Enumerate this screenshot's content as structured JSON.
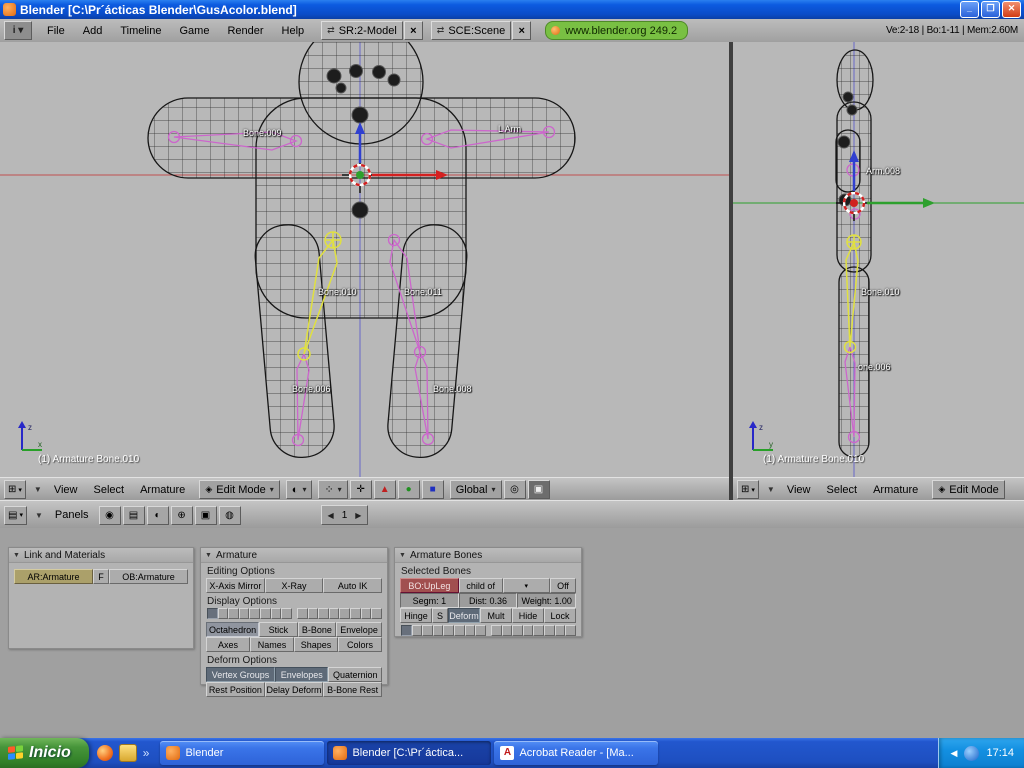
{
  "window": {
    "title": "Blender [C:\\Pr´ácticas Blender\\GusAcolor.blend]"
  },
  "menubar": {
    "menus": [
      "File",
      "Add",
      "Timeline",
      "Game",
      "Render",
      "Help"
    ],
    "screen": "SR:2-Model",
    "scene": "SCE:Scene",
    "web": "www.blender.org 249.2",
    "stats": "Ve:2-18 | Bo:1-11 | Mem:2.60M"
  },
  "viewport_front": {
    "labels": [
      "Bone.009",
      "L Arm",
      "Bone.010",
      "Bone.011",
      "Bone.006",
      "Bone.008"
    ],
    "status": "(1) Armature Bone.010",
    "axis_v": "z",
    "axis_h": "x"
  },
  "viewport_side": {
    "labels": [
      "Arm.008",
      "Bone.010",
      "one.006"
    ],
    "status": "(1) Armature Bone.010",
    "axis_v": "z",
    "axis_h": "y"
  },
  "header_front": {
    "menus": [
      "View",
      "Select",
      "Armature"
    ],
    "mode": "Edit Mode",
    "orientation": "Global"
  },
  "header_side": {
    "menus": [
      "View",
      "Select",
      "Armature"
    ],
    "mode": "Edit Mode"
  },
  "buttons_header": {
    "panels": "Panels",
    "frame": "1"
  },
  "panel_link": {
    "title": "Link and Materials",
    "ar": "AR:Armature",
    "f": "F",
    "ob": "OB:Armature"
  },
  "panel_armature": {
    "title": "Armature",
    "editing_options": "Editing Options",
    "row1": [
      "X-Axis Mirror",
      "X-Ray",
      "Auto IK"
    ],
    "display_options": "Display Options",
    "row2": [
      "Octahedron",
      "Stick",
      "B-Bone",
      "Envelope"
    ],
    "row3": [
      "Axes",
      "Names",
      "Shapes",
      "Colors"
    ],
    "deform_options": "Deform Options",
    "row4": [
      "Vertex Groups",
      "Envelopes",
      "Quaternion"
    ],
    "row5": [
      "Rest Position",
      "Delay Deform",
      "B-Bone Rest"
    ]
  },
  "panel_bones": {
    "title": "Armature Bones",
    "selected_bones": "Selected Bones",
    "bone_name": "BO:UpLeg",
    "child_of": "child of",
    "child_value": "Off",
    "segm": "Segm: 1",
    "dist": "Dist: 0.36",
    "weight": "Weight: 1.00",
    "toggles": [
      "Hinge",
      "S",
      "Deform",
      "Mult",
      "Hide",
      "Lock"
    ]
  },
  "taskbar": {
    "start": "Inicio",
    "tasks": [
      "Blender",
      "Blender [C:\\Pr´áctica...",
      "Acrobat Reader - [Ma..."
    ],
    "time": "17:14"
  }
}
